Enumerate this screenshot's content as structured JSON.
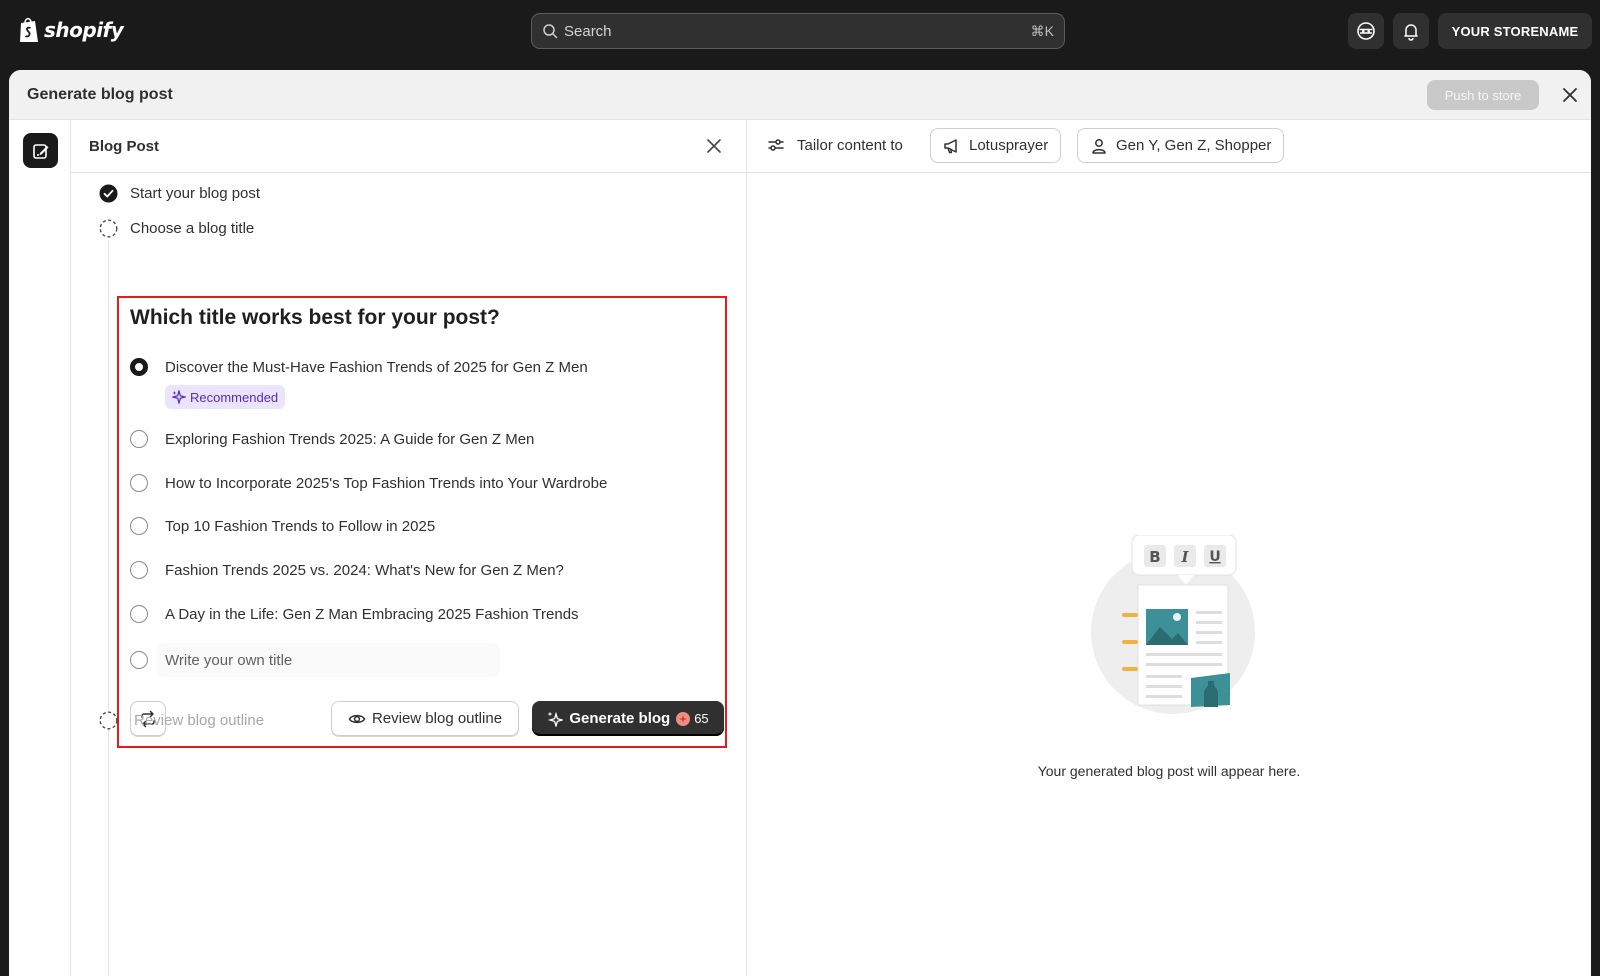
{
  "topbar": {
    "logo_text": "shopify",
    "search": {
      "placeholder": "Search",
      "shortcut": "⌘K"
    },
    "icons": [
      "sidekick-icon",
      "bell-icon"
    ],
    "store_button": "YOUR STORENAME"
  },
  "modal": {
    "title": "Generate blog post",
    "push_button": "Push to store"
  },
  "left_panel": {
    "title": "Blog Post",
    "steps": [
      {
        "label": "Start your blog post",
        "status": "complete"
      },
      {
        "label": "Choose a blog title",
        "status": "current"
      },
      {
        "label": "Review blog outline",
        "status": "upcoming"
      }
    ],
    "card": {
      "question": "Which title works best for your post?",
      "options": [
        {
          "label": "Discover the Must-Have Fashion Trends of 2025 for Gen Z Men",
          "selected": true
        },
        {
          "label": "Exploring Fashion Trends 2025: A Guide for Gen Z Men",
          "selected": false
        },
        {
          "label": "How to Incorporate 2025's Top Fashion Trends into Your Wardrobe",
          "selected": false
        },
        {
          "label": "Top 10 Fashion Trends to Follow in 2025",
          "selected": false
        },
        {
          "label": "Fashion Trends 2025 vs. 2024: What's New for Gen Z Men?",
          "selected": false
        },
        {
          "label": "A Day in the Life: Gen Z Man Embracing 2025 Fashion Trends",
          "selected": false
        }
      ],
      "recommended_badge": "Recommended",
      "own_title_placeholder": "Write your own title",
      "review_button": "Review blog outline",
      "generate_button": "Generate blog",
      "credits": "65"
    }
  },
  "right_panel": {
    "tailor_label": "Tailor content to",
    "chips": [
      "Lotusprayer",
      "Gen Y, Gen Z, Shopper"
    ],
    "empty_message": "Your generated blog post will appear here."
  },
  "colors": {
    "topbar_bg": "#1a1a1a",
    "highlight_border": "#e01e1e",
    "badge_bg": "#eae4ff",
    "badge_text": "#5a2bb5"
  }
}
